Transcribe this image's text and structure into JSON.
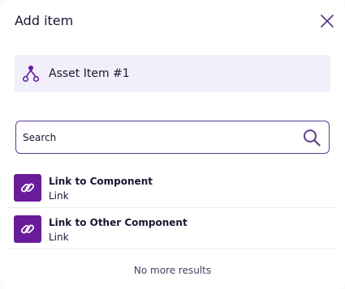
{
  "dialog": {
    "title": "Add item",
    "close_icon": "close-icon"
  },
  "asset": {
    "icon": "asset-tree-icon",
    "label": "Asset Item #1"
  },
  "search": {
    "placeholder": "Search",
    "value": "",
    "icon": "search-icon"
  },
  "results": [
    {
      "title": "Link to Component",
      "subtitle": "Link",
      "icon": "link-icon"
    },
    {
      "title": "Link to Other Component",
      "subtitle": "Link",
      "icon": "link-icon"
    }
  ],
  "footer": {
    "message": "No more results"
  },
  "colors": {
    "accent": "#6a1b9a",
    "text": "#1d1433",
    "asset_bg": "#f1eff9",
    "search_border": "#5c3b8f"
  }
}
